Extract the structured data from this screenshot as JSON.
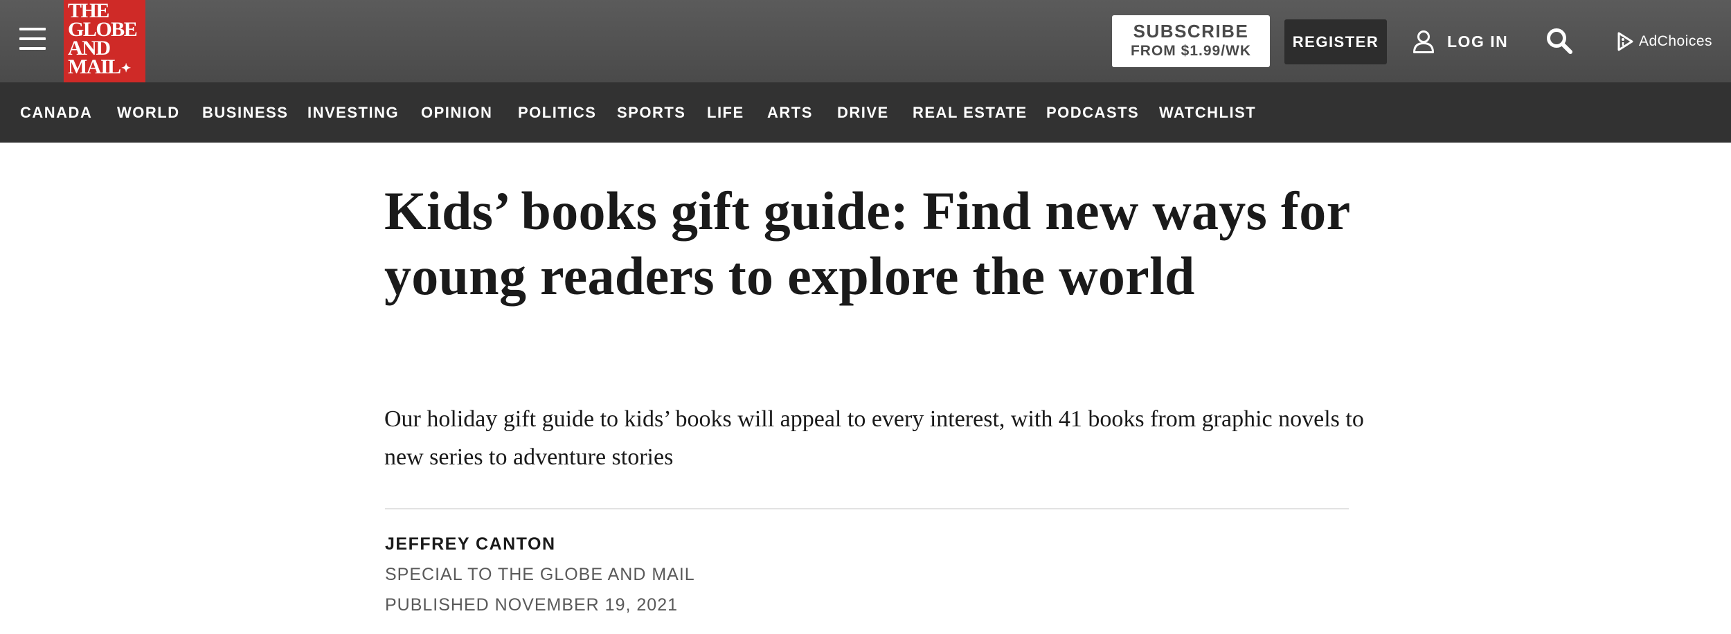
{
  "header": {
    "menu_icon": "hamburger-menu-icon",
    "logo_lines": [
      "THE",
      "GLOBE",
      "AND",
      "MAIL"
    ],
    "logo_leaf_icon": "maple-leaf-icon",
    "brand_color": "#cf2a27",
    "subscribe_label": "SUBSCRIBE",
    "subscribe_price": "FROM $1.99/WK",
    "register_label": "REGISTER",
    "login_icon": "user-icon",
    "login_label": "LOG IN",
    "search_icon": "search-icon",
    "adchoices_icon": "adchoices-icon",
    "adchoices_label": "AdChoices"
  },
  "nav": {
    "items": [
      "CANADA",
      "WORLD",
      "BUSINESS",
      "INVESTING",
      "OPINION",
      "POLITICS",
      "SPORTS",
      "LIFE",
      "ARTS",
      "DRIVE",
      "REAL ESTATE",
      "PODCASTS",
      "WATCHLIST"
    ]
  },
  "article": {
    "headline": "Kids’ books gift guide: Find new ways for young readers to explore the world",
    "dek": "Our holiday gift guide to kids’ books will appeal to every interest, with 41 books from graphic novels to new series to adventure stories",
    "author": "JEFFREY CANTON",
    "affiliation": "SPECIAL TO THE GLOBE AND MAIL",
    "published": "PUBLISHED NOVEMBER 19, 2021"
  },
  "colors": {
    "topbar": "#4f4f4f",
    "navbar": "#323232",
    "register_bg": "#2d2d2d",
    "meta_text": "#595959"
  }
}
